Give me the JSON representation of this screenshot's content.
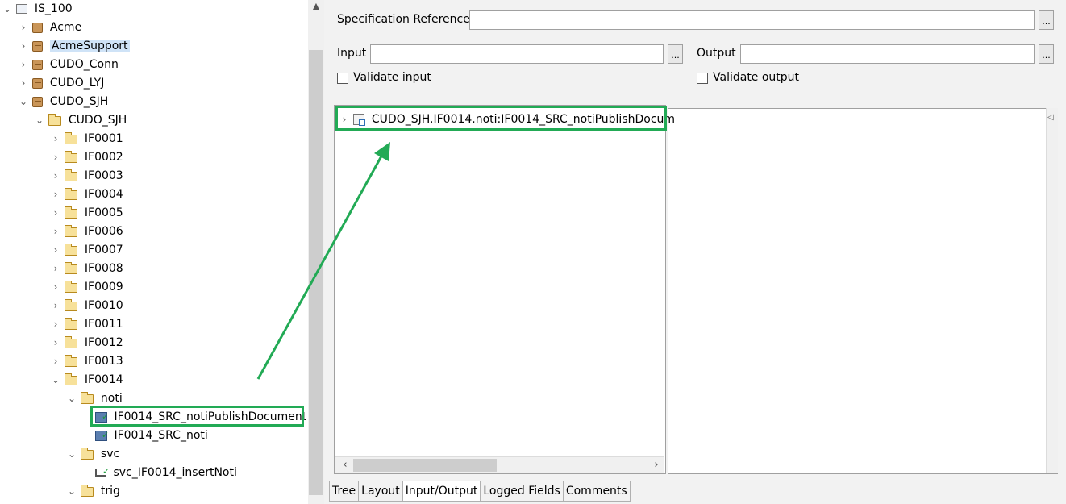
{
  "tree": {
    "root": "IS_100",
    "items": [
      {
        "label": "Acme",
        "type": "package"
      },
      {
        "label": "AcmeSupport",
        "type": "package"
      },
      {
        "label": "CUDO_Conn",
        "type": "package"
      },
      {
        "label": "CUDO_LYJ",
        "type": "package"
      },
      {
        "label": "CUDO_SJH",
        "type": "package"
      },
      {
        "label": "CUDO_SJH",
        "type": "folder"
      },
      {
        "label": "IF0001",
        "type": "folder"
      },
      {
        "label": "IF0002",
        "type": "folder"
      },
      {
        "label": "IF0003",
        "type": "folder"
      },
      {
        "label": "IF0004",
        "type": "folder"
      },
      {
        "label": "IF0005",
        "type": "folder"
      },
      {
        "label": "IF0006",
        "type": "folder"
      },
      {
        "label": "IF0007",
        "type": "folder"
      },
      {
        "label": "IF0008",
        "type": "folder"
      },
      {
        "label": "IF0009",
        "type": "folder"
      },
      {
        "label": "IF0010",
        "type": "folder"
      },
      {
        "label": "IF0011",
        "type": "folder"
      },
      {
        "label": "IF0012",
        "type": "folder"
      },
      {
        "label": "IF0013",
        "type": "folder"
      },
      {
        "label": "IF0014",
        "type": "folder"
      },
      {
        "label": "noti",
        "type": "folder"
      },
      {
        "label": "IF0014_SRC_notiPublishDocument",
        "type": "service"
      },
      {
        "label": "IF0014_SRC_noti",
        "type": "service"
      },
      {
        "label": "svc",
        "type": "folder"
      },
      {
        "label": "svc_IF0014_insertNoti",
        "type": "flow"
      },
      {
        "label": "trig",
        "type": "folder"
      }
    ]
  },
  "form": {
    "spec_ref_label": "Specification Reference",
    "spec_ref_value": "",
    "input_label": "Input",
    "input_value": "",
    "output_label": "Output",
    "output_value": "",
    "browse": "...",
    "validate_input": "Validate input",
    "validate_output": "Validate output"
  },
  "io_panel": {
    "document_ref": "CUDO_SJH.IF0014.noti:IF0014_SRC_notiPublishDocum"
  },
  "tabs": [
    "Tree",
    "Layout",
    "Input/Output",
    "Logged Fields",
    "Comments"
  ],
  "active_tab": "Input/Output",
  "colors": {
    "highlight": "#22aa55",
    "selection": "#cfe3f7"
  }
}
